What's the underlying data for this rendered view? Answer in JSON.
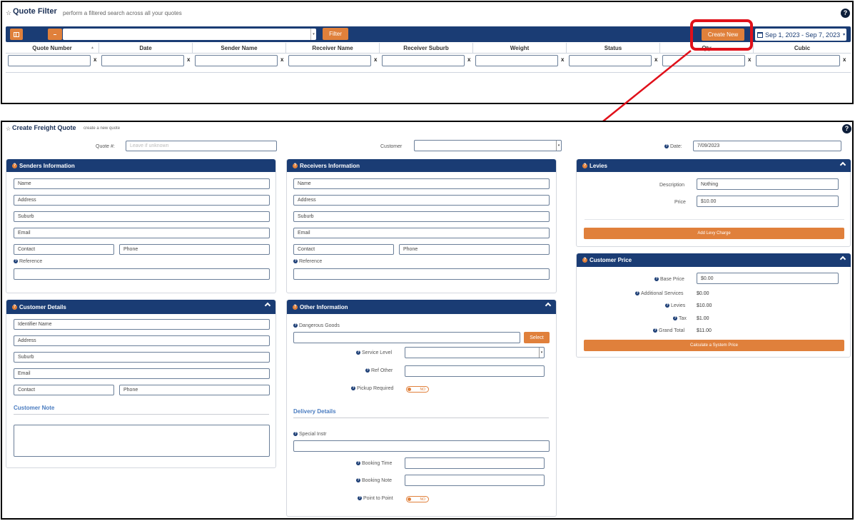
{
  "quote_filter": {
    "title": "Quote Filter",
    "subtitle": "perform a filtered search across all your quotes",
    "filter_button": "Filter",
    "create_new_button": "Create New",
    "date_range": "Sep 1, 2023 - Sep 7, 2023",
    "columns": [
      "Quote Number",
      "Date",
      "Sender Name",
      "Receiver Name",
      "Receiver Suburb",
      "Weight",
      "Status",
      "Qty",
      "Cubic"
    ],
    "clear_symbol": "x"
  },
  "create_quote": {
    "title": "Create Freight Quote",
    "subtitle": "create a new quote",
    "quote_label": "Quote #:",
    "quote_placeholder": "Leave if unknown",
    "customer_label": "Customer",
    "date_label": "Date:",
    "date_value": "7/09/2023"
  },
  "senders": {
    "title": "Senders Information",
    "name": "Name",
    "address": "Address",
    "suburb": "Suburb",
    "email": "Email",
    "contact": "Contact",
    "phone": "Phone",
    "reference": "Reference"
  },
  "receivers": {
    "title": "Receivers Information",
    "name": "Name",
    "address": "Address",
    "suburb": "Suburb",
    "email": "Email",
    "contact": "Contact",
    "phone": "Phone",
    "reference": "Reference"
  },
  "customer_details": {
    "title": "Customer Details",
    "identifier": "Identifier Name",
    "address": "Address",
    "suburb": "Suburb",
    "email": "Email",
    "contact": "Contact",
    "phone": "Phone",
    "note_label": "Customer Note"
  },
  "other_info": {
    "title": "Other Information",
    "dangerous_goods": "Dangerous Goods",
    "select_button": "Select",
    "service_level": "Service Level",
    "ref_other": "Ref Other",
    "pickup_required": "Pickup Required",
    "toggle_no": "NO",
    "delivery_details": "Delivery Details",
    "special_instr": "Special Instr",
    "booking_time": "Booking Time",
    "booking_note": "Booking Note",
    "point_to_point": "Point to Point"
  },
  "levies": {
    "title": "Levies",
    "description_label": "Description",
    "description_value": "Nothing",
    "price_label": "Price",
    "price_value": "$10.00",
    "add_button": "Add Levy Charge"
  },
  "customer_price": {
    "title": "Customer Price",
    "base_price_label": "Base Price",
    "base_price_value": "$0.00",
    "additional_label": "Additional Services",
    "additional_value": "$0.00",
    "levies_label": "Levies",
    "levies_value": "$10.00",
    "tax_label": "Tax",
    "tax_value": "$1.00",
    "grand_total_label": "Grand Total",
    "grand_total_value": "$11.00",
    "calc_button": "Calculate a System Price"
  },
  "icons": {
    "help": "?",
    "question": "?",
    "star": "☆"
  },
  "colors": {
    "navy": "#1a3c74",
    "orange": "#e0803b",
    "highlight_red": "#e0101a"
  }
}
